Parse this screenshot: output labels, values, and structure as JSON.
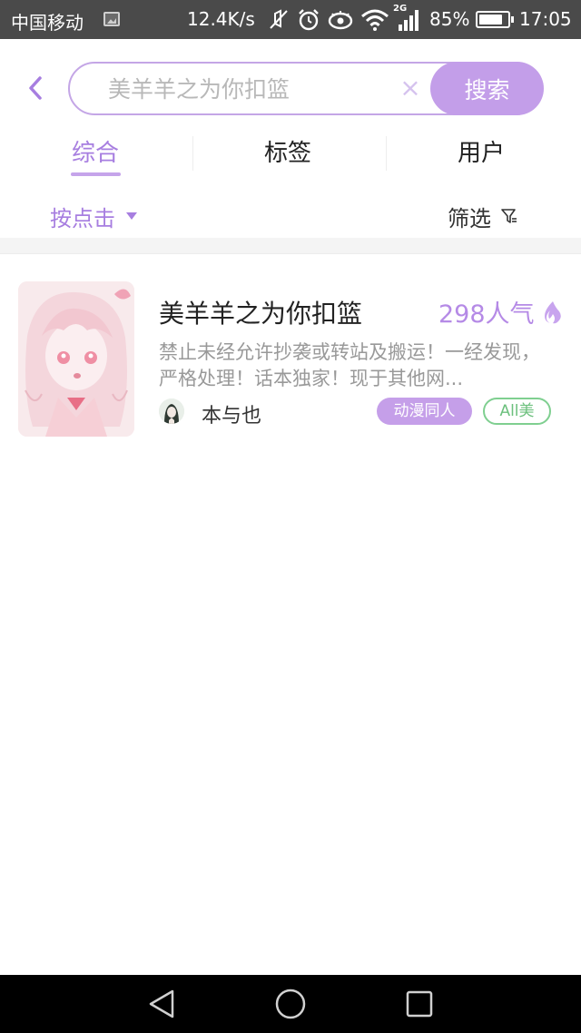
{
  "status_bar": {
    "carrier": "中国移动",
    "speed": "12.4K/s",
    "network": "2G",
    "battery_percent": "85%",
    "battery_level": 0.85,
    "time": "17:05",
    "icons": [
      "image-notification-icon",
      "mute-icon",
      "alarm-icon",
      "eye-icon",
      "wifi-icon",
      "signal-icon",
      "battery-icon"
    ]
  },
  "search": {
    "placeholder": "美羊羊之为你扣篮",
    "clear_icon": "×",
    "button_label": "搜索"
  },
  "tabs": [
    {
      "label": "综合",
      "active": true
    },
    {
      "label": "标签",
      "active": false
    },
    {
      "label": "用户",
      "active": false
    }
  ],
  "sort": {
    "label": "按点击"
  },
  "filter": {
    "label": "筛选"
  },
  "results": [
    {
      "title": "美羊羊之为你扣篮",
      "popularity": "298人气",
      "description": "禁止未经允许抄袭或转站及搬运！一经发现，严格处理！话本独家！现于其他网...",
      "author": "本与也",
      "tags": [
        "动漫同人",
        "All美"
      ]
    }
  ],
  "colors": {
    "accent": "#a77ee0",
    "search_button": "#c39ee9",
    "tag_primary": "#c59fe9",
    "tag_secondary": "#7fcf90",
    "status_bar_bg": "#4a4a4a"
  }
}
